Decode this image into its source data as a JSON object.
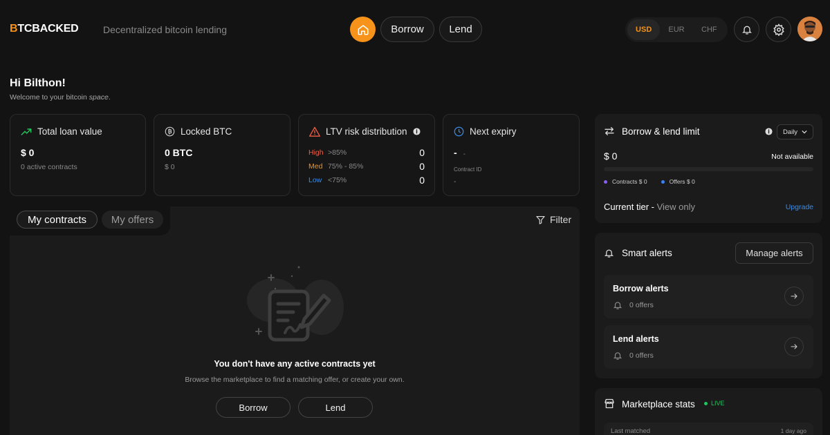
{
  "colors": {
    "accent": "#f7931a",
    "high": "#f05d44",
    "med": "#f7931a",
    "low": "#3b8ce6",
    "live": "#22c55e",
    "contracts_dot": "#8b5cf6",
    "offers_dot": "#3b82f6"
  },
  "header": {
    "logo_b": "B",
    "logo_rest": "TCBACKED",
    "tagline": "Decentralized bitcoin lending",
    "nav": {
      "borrow": "Borrow",
      "lend": "Lend"
    },
    "currencies": [
      "USD",
      "EUR",
      "CHF"
    ],
    "selected_currency": "USD"
  },
  "greeting": {
    "title": "Hi Bilthon!",
    "welcome_prefix": "Welcome to your bitcoin ",
    "welcome_em": "space",
    "welcome_suffix": "."
  },
  "stats": {
    "total_loan": {
      "title": "Total loan value",
      "value": "$ 0",
      "sub": "0 active contracts"
    },
    "locked_btc": {
      "title": "Locked BTC",
      "value": "0 BTC",
      "sub": "$ 0"
    },
    "ltv": {
      "title": "LTV risk distribution",
      "rows": [
        {
          "label": "High",
          "range": ">85%",
          "count": "0"
        },
        {
          "label": "Med",
          "range": "75% - 85%",
          "count": "0"
        },
        {
          "label": "Low",
          "range": "<75%",
          "count": "0"
        }
      ]
    },
    "expiry": {
      "title": "Next expiry",
      "value": "-",
      "value_sub": "-",
      "contract_label": "Contract ID",
      "contract_value": "-"
    }
  },
  "contracts": {
    "tabs": [
      "My contracts",
      "My offers"
    ],
    "filter": "Filter",
    "empty_title": "You don't have any active contracts yet",
    "empty_sub": "Browse the marketplace to find a matching offer, or create your own.",
    "borrow": "Borrow",
    "lend": "Lend"
  },
  "limit": {
    "title": "Borrow & lend limit",
    "period": "Daily",
    "value": "$ 0",
    "availability": "Not available",
    "contracts": "Contracts $ 0",
    "offers": "Offers $ 0",
    "tier_label": "Current tier - ",
    "tier_value": "View only",
    "upgrade": "Upgrade"
  },
  "alerts": {
    "title": "Smart alerts",
    "manage": "Manage alerts",
    "items": [
      {
        "title": "Borrow alerts",
        "sub": "0 offers"
      },
      {
        "title": "Lend alerts",
        "sub": "0 offers"
      }
    ]
  },
  "market": {
    "title": "Marketplace stats",
    "live": "LIVE",
    "last_matched": "Last matched",
    "ago": "1 day ago"
  }
}
